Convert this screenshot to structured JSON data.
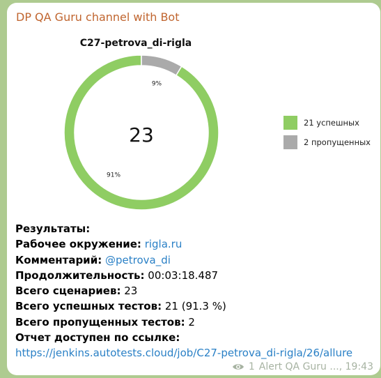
{
  "message": {
    "channel_title": "DP QA Guru channel with Bot",
    "views": "1",
    "author": "Alert QA Guru ...",
    "time": "19:43"
  },
  "chart_data": {
    "type": "pie",
    "title": "C27-petrova_di-rigla",
    "center_label": "23",
    "slices": [
      {
        "name": "21 успешных",
        "value": 21,
        "label": "91%",
        "color": "#8fcd63"
      },
      {
        "name": "2 пропущенных",
        "value": 2,
        "label": "9%",
        "color": "#aaaaaa"
      }
    ],
    "legend_position": "right"
  },
  "results": {
    "header": "Результаты:",
    "env_label": "Рабочее окружение:",
    "env_value": "rigla.ru",
    "comment_label": "Комментарий:",
    "comment_value": "@petrova_di",
    "duration_label": "Продолжительность:",
    "duration_value": "00:03:18.487",
    "scenarios_label": "Всего сценариев:",
    "scenarios_value": "23",
    "passed_label": "Всего успешных тестов:",
    "passed_value": "21 (91.3 %)",
    "skipped_label": "Всего пропущенных тестов:",
    "skipped_value": "2",
    "report_label": "Отчет доступен по ссылке:",
    "report_url": "https://jenkins.autotests.cloud/job/C27-petrova_di-rigla/26/allure"
  }
}
